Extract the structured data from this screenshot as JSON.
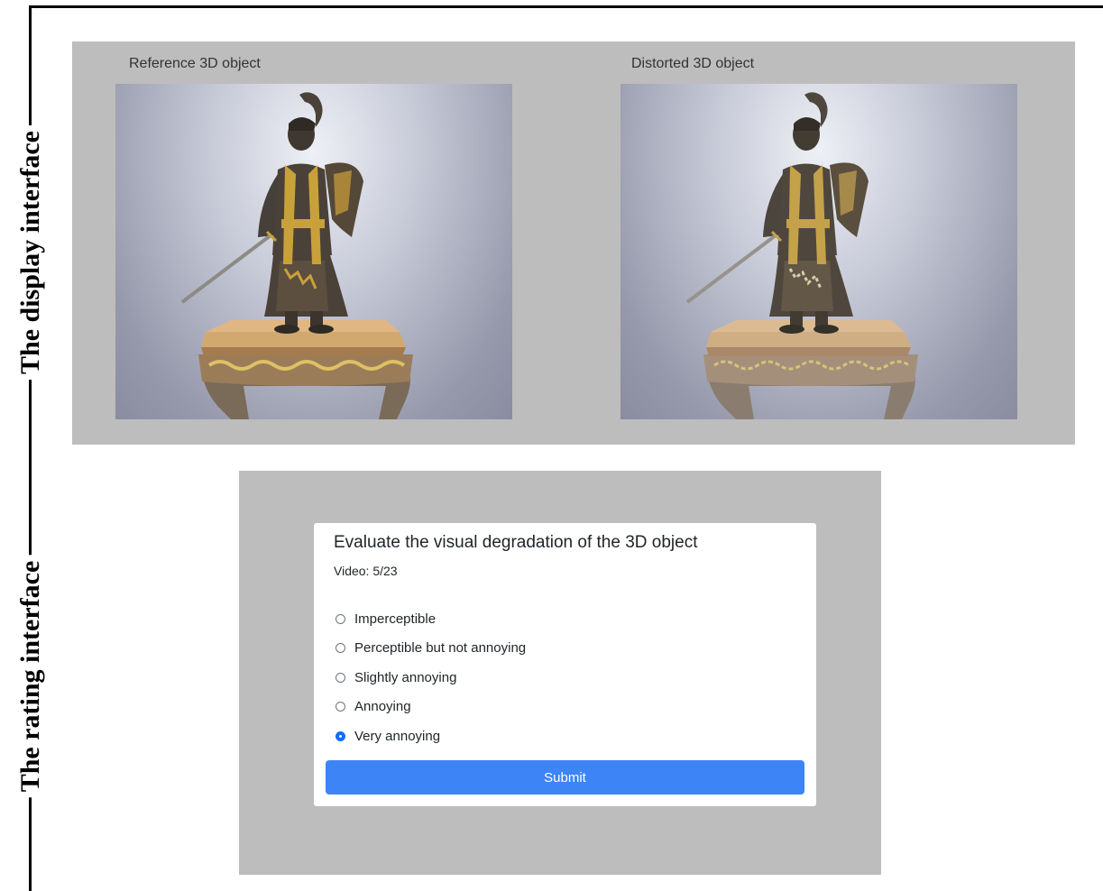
{
  "labels": {
    "display_interface": "The display interface",
    "rating_interface": "The rating interface"
  },
  "display": {
    "reference_caption": "Reference 3D object",
    "distorted_caption": "Distorted 3D object",
    "scene": "bronze samurai statue on ornate wooden pedestal"
  },
  "rating": {
    "title": "Evaluate the visual degradation of the 3D object",
    "progress": "Video: 5/23",
    "options": [
      {
        "label": "Imperceptible",
        "selected": false
      },
      {
        "label": "Perceptible but not annoying",
        "selected": false
      },
      {
        "label": "Slightly annoying",
        "selected": false
      },
      {
        "label": "Annoying",
        "selected": false
      },
      {
        "label": "Very annoying",
        "selected": true
      }
    ],
    "submit_label": "Submit"
  },
  "colors": {
    "panel_bg": "#bdbdbd",
    "submit_bg": "#3d84f7",
    "radio_selected": "#0d6efd",
    "statue_bronze": "#4a4238",
    "statue_gold": "#c9a13a",
    "pedestal_wood": "#c79a62"
  }
}
